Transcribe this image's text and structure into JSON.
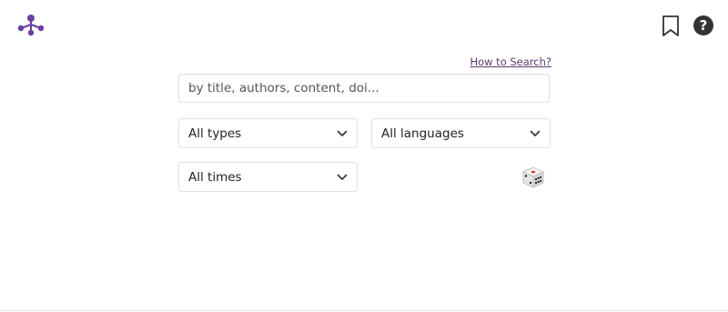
{
  "colors": {
    "brand": "#6b3fa0",
    "link": "#5a3a6e",
    "border": "#dedede",
    "text": "#222222"
  },
  "header": {
    "logo_icon": "network-logo-icon",
    "bookmark_icon": "bookmark-icon",
    "help_icon": "help-circle-icon",
    "help_glyph": "?"
  },
  "search": {
    "help_link": "How to Search?",
    "placeholder": "by title, authors, content, doi...",
    "value": ""
  },
  "filters": {
    "type": {
      "selected": "All types"
    },
    "language": {
      "selected": "All languages"
    },
    "time": {
      "selected": "All times"
    }
  },
  "random_icon": "dice-icon"
}
